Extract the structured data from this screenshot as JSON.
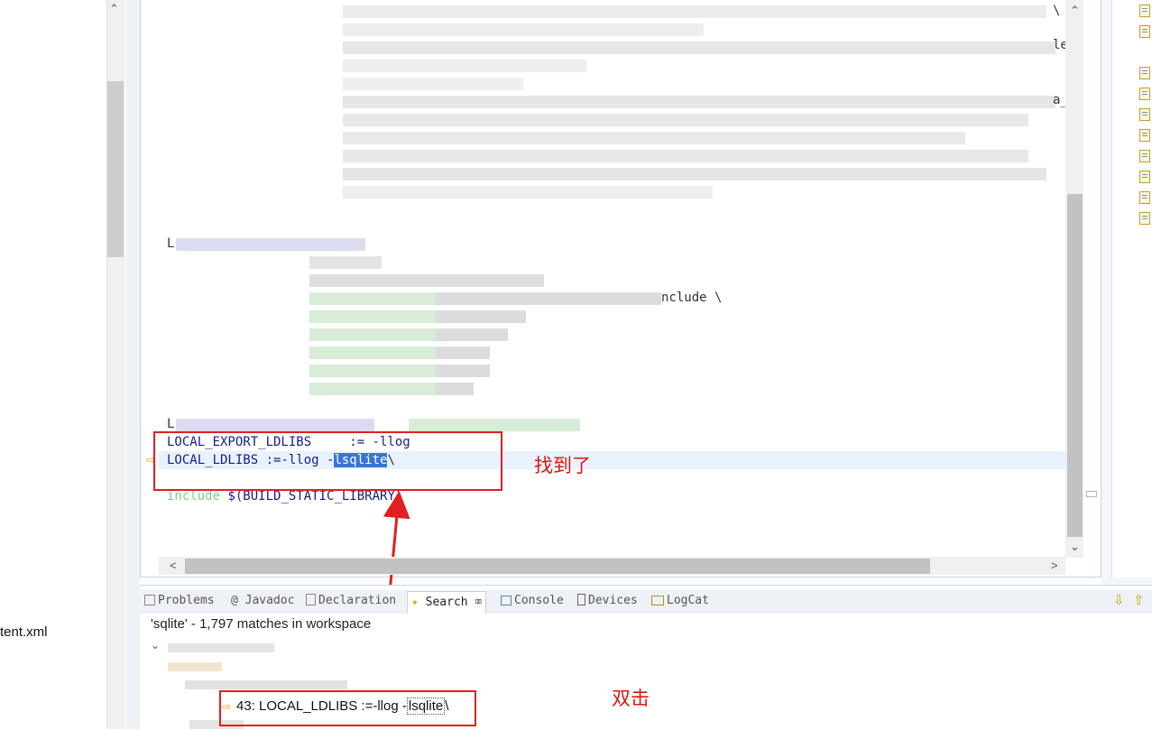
{
  "left_panel": {
    "file_label": "tent.xml"
  },
  "editor": {
    "var_prefix_1": "L",
    "include_fragment": "nclude \\",
    "line_trail_1": "\\",
    "line_trail_2": "le",
    "line_trail_3": "a_",
    "var_prefix_2": "L",
    "export_line": "LOCAL_EXPORT_LDLIBS     := -llog",
    "ldlibs_prefix": "LOCAL_LDLIBS :=-llog -",
    "ldlibs_selected": "lsqlite",
    "ldlibs_suffix": "\\",
    "include_keyword": "include",
    "include_rest": " $(BUILD_STATIC_LIBRARY)"
  },
  "annotations": {
    "found_label": "找到了",
    "double_click_label": "双击"
  },
  "bottom": {
    "tabs": [
      {
        "label": "Problems"
      },
      {
        "label": "Javadoc"
      },
      {
        "label": "Declaration"
      },
      {
        "label": "Search"
      },
      {
        "label": "Console"
      },
      {
        "label": "Devices"
      },
      {
        "label": "LogCat"
      }
    ],
    "search_summary": "'sqlite' - 1,797 matches in workspace",
    "match_prefix": "43: LOCAL_LDLIBS :=-llog -",
    "match_highlight": "lsqlite",
    "match_suffix": "\\"
  },
  "colors": {
    "annotation_red": "#e02020",
    "selection_blue": "#3875d7",
    "current_line": "#e8f2fe"
  },
  "icons": [
    "tip-arrow-icon",
    "scroll-up-icon",
    "scroll-down-icon",
    "scroll-left-icon",
    "scroll-right-icon",
    "close-icon",
    "minimize-icon",
    "maximize-icon",
    "file-icon"
  ]
}
